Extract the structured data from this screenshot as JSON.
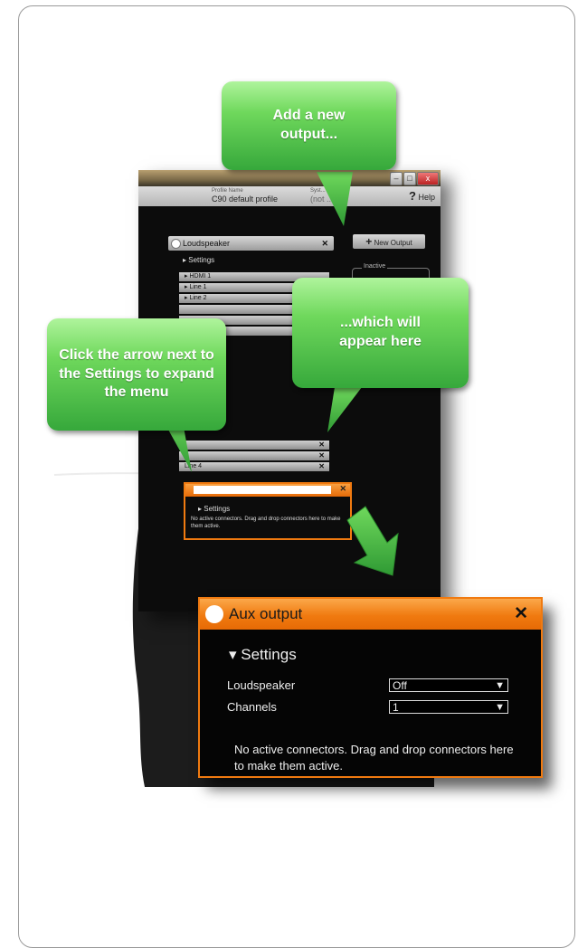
{
  "callouts": {
    "add_output": "Add a new output...",
    "appear_here": "...which will appear here",
    "click_arrow": "Click the arrow next to the Settings to expand the menu"
  },
  "app": {
    "profile_label": "Profile Name",
    "profile_value": "C90 default profile",
    "status_label": "Syst...",
    "status_value": "(not ...ed)",
    "help_label": "Help",
    "new_output_label": "New Output",
    "inactive_label": "Inactive",
    "loudspeaker_panel": {
      "title": "Loudspeaker",
      "settings_label": "Settings",
      "connectors": [
        "HDMI 1",
        "Line 1",
        "Line 2"
      ]
    },
    "lower_connectors": [
      "",
      "",
      "Line 4"
    ],
    "small_aux": {
      "settings_label": "Settings",
      "message": "No active connectors. Drag and drop connectors here to make them active."
    }
  },
  "aux_output": {
    "title": "Aux output",
    "settings_label": "Settings",
    "fields": [
      {
        "label": "Loudspeaker",
        "value": "Off"
      },
      {
        "label": "Channels",
        "value": "1"
      }
    ],
    "message": "No active connectors. Drag and drop connectors here to make them active."
  },
  "colors": {
    "orange": "#f07a10",
    "green": "#4cc04a",
    "dark": "#0c0c0c"
  }
}
